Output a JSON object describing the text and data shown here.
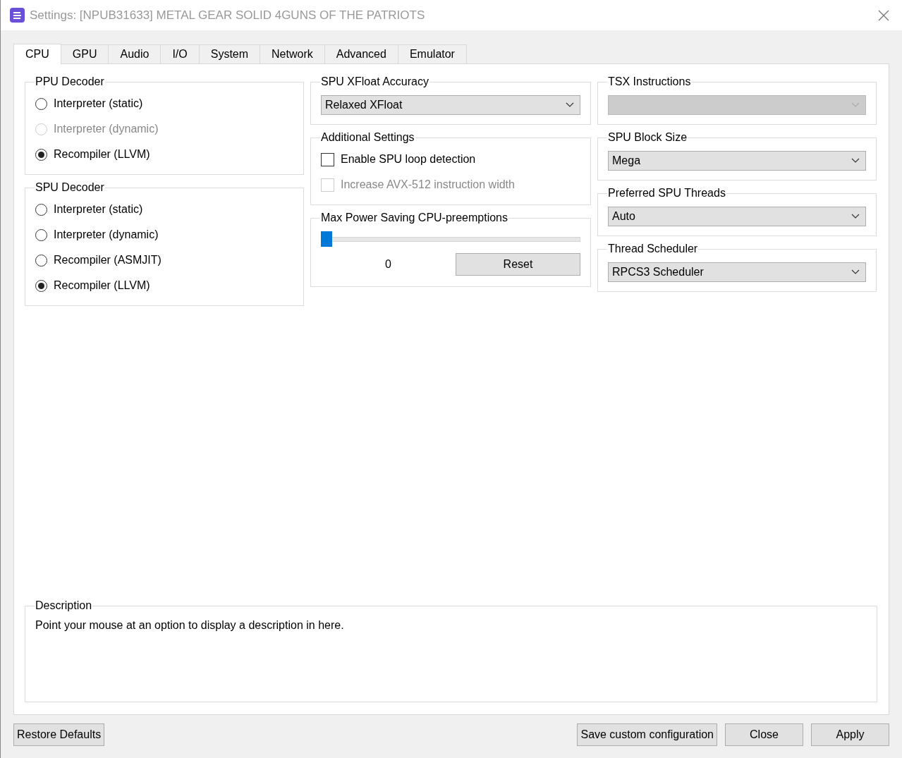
{
  "window": {
    "title": "Settings: [NPUB31633] METAL GEAR SOLID 4GUNS OF THE PATRIOTS"
  },
  "tabs": [
    {
      "label": "CPU",
      "selected": true
    },
    {
      "label": "GPU",
      "selected": false
    },
    {
      "label": "Audio",
      "selected": false
    },
    {
      "label": "I/O",
      "selected": false
    },
    {
      "label": "System",
      "selected": false
    },
    {
      "label": "Network",
      "selected": false
    },
    {
      "label": "Advanced",
      "selected": false
    },
    {
      "label": "Emulator",
      "selected": false
    }
  ],
  "columns": [
    [
      {
        "kind": "radios",
        "title": "PPU Decoder",
        "items": [
          {
            "label": "Interpreter (static)",
            "selected": false,
            "disabled": false
          },
          {
            "label": "Interpreter (dynamic)",
            "selected": false,
            "disabled": true
          },
          {
            "label": "Recompiler (LLVM)",
            "selected": true,
            "disabled": false
          }
        ]
      },
      {
        "kind": "radios",
        "title": "SPU Decoder",
        "items": [
          {
            "label": "Interpreter (static)",
            "selected": false,
            "disabled": false
          },
          {
            "label": "Interpreter (dynamic)",
            "selected": false,
            "disabled": false
          },
          {
            "label": "Recompiler (ASMJIT)",
            "selected": false,
            "disabled": false
          },
          {
            "label": "Recompiler (LLVM)",
            "selected": true,
            "disabled": false
          }
        ]
      }
    ],
    [
      {
        "kind": "dropdown",
        "title": "SPU XFloat Accuracy",
        "value": "Relaxed XFloat",
        "disabled": false
      },
      {
        "kind": "checks",
        "title": "Additional Settings",
        "items": [
          {
            "label": "Enable SPU loop detection",
            "checked": false,
            "disabled": false
          },
          {
            "label": "Increase AVX-512 instruction width",
            "checked": false,
            "disabled": true
          }
        ]
      },
      {
        "kind": "slider",
        "title": "Max Power Saving CPU-preemptions",
        "level": 0,
        "reading": "0",
        "button": "Reset"
      }
    ],
    [
      {
        "kind": "dropdown",
        "title": "TSX Instructions",
        "disabled": true
      },
      {
        "kind": "dropdown",
        "title": "SPU Block Size",
        "value": "Mega",
        "disabled": false
      },
      {
        "kind": "dropdown",
        "title": "Preferred SPU Threads",
        "value": "Auto",
        "disabled": false
      },
      {
        "kind": "dropdown",
        "title": "Thread Scheduler",
        "value": "RPCS3 Scheduler",
        "disabled": false
      }
    ]
  ],
  "description": {
    "title": "Description",
    "text": "Point your mouse at an option to display a description in here."
  },
  "buttons_left": [
    "Restore Defaults"
  ],
  "buttons_right": [
    "Save custom configuration",
    "Close",
    "Apply"
  ]
}
